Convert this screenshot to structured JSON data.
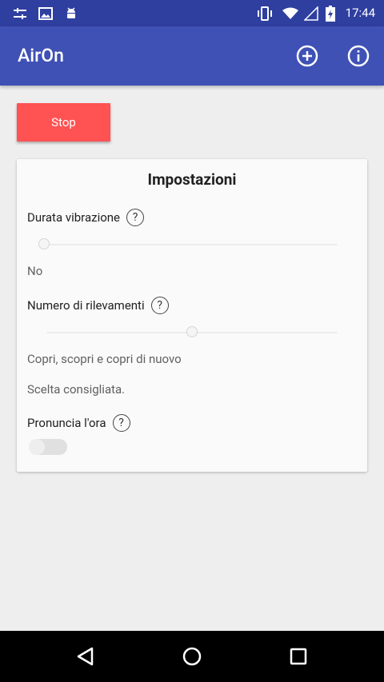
{
  "status_bar": {
    "time": "17:44",
    "left_icons": [
      "tune-icon",
      "image-icon",
      "android-icon"
    ],
    "right_icons": [
      "vibrate-icon",
      "wifi-icon",
      "signal-icon",
      "battery-charging-icon"
    ]
  },
  "app_bar": {
    "title": "AirOn",
    "actions": [
      "add-circle-icon",
      "info-icon"
    ]
  },
  "stop_button": {
    "label": "Stop",
    "color": "#ff5252"
  },
  "settings_card": {
    "title": "Impostazioni",
    "vibration": {
      "label": "Durata vibrazione",
      "help": "?",
      "value_label": "No",
      "slider_level": 0
    },
    "readings": {
      "label": "Numero di rilevamenti",
      "help": "?",
      "value_label": "Copri, scopri e copri di nuovo",
      "hint": "Scelta consigliata.",
      "slider_level": 0.5
    },
    "speak_time": {
      "label": "Pronuncia l'ora",
      "help": "?",
      "switch_on": false
    }
  },
  "colors": {
    "primary": "#3f51b5",
    "primary_dark": "#2f3fa0",
    "accent": "#ff5252",
    "background": "#eeeeee"
  },
  "nav_bar": {
    "buttons": [
      "back-icon",
      "home-icon",
      "recents-icon"
    ]
  }
}
